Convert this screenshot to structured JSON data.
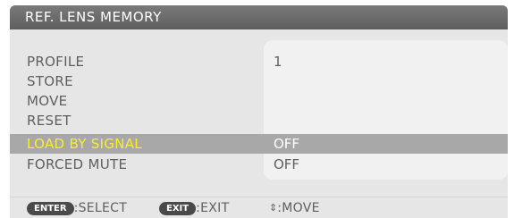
{
  "menu": {
    "title": "REF. LENS MEMORY",
    "items": [
      {
        "label": "PROFILE",
        "value": "1"
      },
      {
        "label": "STORE",
        "value": ""
      },
      {
        "label": "MOVE",
        "value": ""
      },
      {
        "label": "RESET",
        "value": ""
      },
      {
        "label": "LOAD BY SIGNAL",
        "value": "OFF"
      },
      {
        "label": "FORCED MUTE",
        "value": "OFF"
      }
    ],
    "selected_item": "LOAD BY SIGNAL"
  },
  "footer": {
    "enter_key": "ENTER",
    "enter_action": ":SELECT",
    "exit_key": "EXIT",
    "exit_action": ":EXIT",
    "move_glyph": "⇕",
    "move_action": ":MOVE"
  },
  "colors": {
    "title_bar": "#6a6a6a",
    "panel_bg": "#e6e6e6",
    "value_panel_bg": "#f1f1f1",
    "selected_row_bg": "#a8a8a8",
    "selected_label": "#f8ef2a",
    "text": "#5f5f5f"
  }
}
